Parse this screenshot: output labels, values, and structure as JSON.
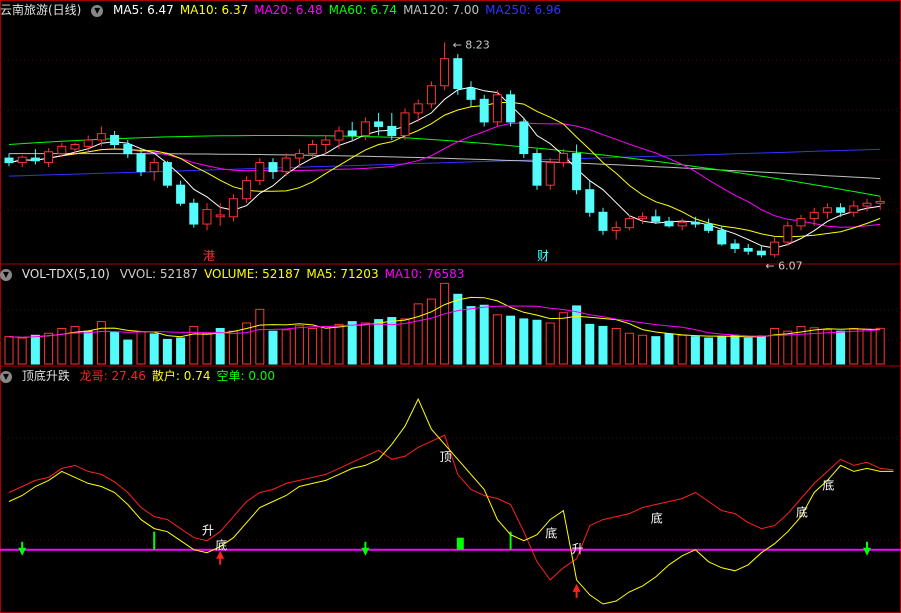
{
  "colors": {
    "bg": "#000000",
    "up": "#ff3333",
    "down": "#54fcfc",
    "frame": "#aa0000",
    "grid": "#5a0000",
    "ma5": "#ffffff",
    "ma10": "#ffff00",
    "ma20": "#ff00ff",
    "ma60": "#00ff00",
    "ma120": "#c0c0c0",
    "ma250": "#3333ff",
    "longge": "#ff2020",
    "sanhu": "#ffff00",
    "kongdan": "#00ff00",
    "zero_line": "#ff00ff"
  },
  "price_panel": {
    "title": "云南旅游(日线)",
    "ma": [
      {
        "label": "MA5: 6.47",
        "color": "#ffffff"
      },
      {
        "label": "MA10: 6.37",
        "color": "#ffff00"
      },
      {
        "label": "MA20: 6.48",
        "color": "#ff00ff"
      },
      {
        "label": "MA60: 6.74",
        "color": "#00ff00"
      },
      {
        "label": "MA120: 7.00",
        "color": "#c0c0c0"
      },
      {
        "label": "MA250: 6.96",
        "color": "#3333ff"
      }
    ],
    "high_label": "8.23",
    "low_label": "6.07",
    "marker_gang": "港",
    "marker_cai": "财"
  },
  "volume_panel": {
    "title": "VOL-TDX(5,10)",
    "items": [
      {
        "label": "VVOL: 52187",
        "color": "#cccccc"
      },
      {
        "label": "VOLUME: 52187",
        "color": "#ffff00"
      },
      {
        "label": "MA5: 71203",
        "color": "#ffff00"
      },
      {
        "label": "MA10: 76583",
        "color": "#ff00ff"
      }
    ]
  },
  "indicator_panel": {
    "title": "顶底升跌",
    "items": [
      {
        "label": "龙哥: 27.46",
        "color": "#ff2020"
      },
      {
        "label": "散户: 0.74",
        "color": "#ffff00"
      },
      {
        "label": "空单: 0.00",
        "color": "#00ff00"
      }
    ],
    "labels": [
      {
        "text": "升",
        "idx": 15
      },
      {
        "text": "底",
        "idx": 16
      },
      {
        "text": "顶",
        "idx": 33
      },
      {
        "text": "底",
        "idx": 41
      },
      {
        "text": "升",
        "idx": 43
      },
      {
        "text": "底",
        "idx": 49
      },
      {
        "text": "底",
        "idx": 60
      },
      {
        "text": "底",
        "idx": 62
      }
    ]
  },
  "chart_data": [
    {
      "type": "candlestick",
      "title": "云南旅游(日线)",
      "ylim": [
        5.8,
        8.5
      ],
      "ohlc": [
        [
          6.95,
          7.0,
          6.86,
          6.9
        ],
        [
          6.9,
          6.98,
          6.85,
          6.96
        ],
        [
          6.95,
          7.05,
          6.88,
          6.92
        ],
        [
          6.9,
          7.06,
          6.85,
          7.02
        ],
        [
          7.0,
          7.12,
          6.96,
          7.08
        ],
        [
          7.05,
          7.12,
          7.0,
          7.1
        ],
        [
          7.08,
          7.2,
          7.03,
          7.15
        ],
        [
          7.15,
          7.3,
          7.08,
          7.22
        ],
        [
          7.2,
          7.25,
          7.05,
          7.1
        ],
        [
          7.1,
          7.15,
          6.95,
          7.0
        ],
        [
          7.0,
          7.05,
          6.75,
          6.8
        ],
        [
          6.8,
          6.95,
          6.7,
          6.9
        ],
        [
          6.9,
          6.92,
          6.62,
          6.65
        ],
        [
          6.65,
          6.7,
          6.42,
          6.45
        ],
        [
          6.45,
          6.5,
          6.18,
          6.22
        ],
        [
          6.22,
          6.45,
          6.15,
          6.38
        ],
        [
          6.3,
          6.45,
          6.2,
          6.32
        ],
        [
          6.3,
          6.55,
          6.25,
          6.5
        ],
        [
          6.5,
          6.75,
          6.45,
          6.7
        ],
        [
          6.7,
          6.95,
          6.65,
          6.9
        ],
        [
          6.9,
          6.95,
          6.72,
          6.8
        ],
        [
          6.8,
          7.0,
          6.75,
          6.95
        ],
        [
          6.95,
          7.05,
          6.85,
          7.0
        ],
        [
          7.0,
          7.15,
          6.95,
          7.1
        ],
        [
          7.1,
          7.2,
          7.0,
          7.15
        ],
        [
          7.15,
          7.3,
          7.05,
          7.25
        ],
        [
          7.25,
          7.35,
          7.15,
          7.2
        ],
        [
          7.2,
          7.4,
          7.15,
          7.35
        ],
        [
          7.35,
          7.45,
          7.2,
          7.3
        ],
        [
          7.3,
          7.45,
          7.15,
          7.2
        ],
        [
          7.2,
          7.5,
          7.15,
          7.45
        ],
        [
          7.45,
          7.6,
          7.35,
          7.55
        ],
        [
          7.55,
          7.8,
          7.5,
          7.75
        ],
        [
          7.75,
          8.23,
          7.7,
          8.05
        ],
        [
          8.05,
          8.1,
          7.65,
          7.72
        ],
        [
          7.72,
          7.8,
          7.52,
          7.6
        ],
        [
          7.6,
          7.65,
          7.3,
          7.35
        ],
        [
          7.35,
          7.7,
          7.3,
          7.65
        ],
        [
          7.65,
          7.7,
          7.3,
          7.35
        ],
        [
          7.35,
          7.4,
          6.95,
          7.0
        ],
        [
          7.0,
          7.05,
          6.6,
          6.65
        ],
        [
          6.65,
          6.95,
          6.6,
          6.9
        ],
        [
          6.9,
          7.05,
          6.85,
          7.0
        ],
        [
          7.0,
          7.1,
          6.55,
          6.6
        ],
        [
          6.6,
          6.7,
          6.3,
          6.35
        ],
        [
          6.35,
          6.4,
          6.1,
          6.15
        ],
        [
          6.15,
          6.25,
          6.05,
          6.18
        ],
        [
          6.18,
          6.32,
          6.15,
          6.28
        ],
        [
          6.28,
          6.35,
          6.22,
          6.3
        ],
        [
          6.3,
          6.38,
          6.22,
          6.25
        ],
        [
          6.25,
          6.3,
          6.18,
          6.2
        ],
        [
          6.2,
          6.28,
          6.15,
          6.24
        ],
        [
          6.24,
          6.3,
          6.18,
          6.22
        ],
        [
          6.22,
          6.28,
          6.12,
          6.15
        ],
        [
          6.15,
          6.2,
          5.98,
          6.0
        ],
        [
          6.0,
          6.05,
          5.9,
          5.95
        ],
        [
          5.95,
          6.0,
          5.88,
          5.92
        ],
        [
          5.92,
          5.98,
          5.85,
          5.88
        ],
        [
          5.88,
          6.07,
          5.85,
          6.02
        ],
        [
          6.02,
          6.25,
          5.98,
          6.2
        ],
        [
          6.2,
          6.32,
          6.15,
          6.28
        ],
        [
          6.28,
          6.4,
          6.2,
          6.35
        ],
        [
          6.35,
          6.45,
          6.28,
          6.4
        ],
        [
          6.4,
          6.45,
          6.3,
          6.35
        ],
        [
          6.35,
          6.48,
          6.3,
          6.42
        ],
        [
          6.42,
          6.5,
          6.36,
          6.45
        ],
        [
          6.45,
          6.52,
          6.38,
          6.47
        ]
      ]
    },
    {
      "type": "bar",
      "title": "VOL-TDX(5,10)",
      "ylim": [
        0,
        120000
      ],
      "values": [
        40000,
        38000,
        42000,
        45000,
        52000,
        55000,
        48000,
        62000,
        46000,
        35000,
        47000,
        44000,
        36000,
        38000,
        55000,
        45000,
        52000,
        48000,
        60000,
        80000,
        48000,
        50000,
        56000,
        52000,
        55000,
        58000,
        62000,
        60000,
        65000,
        68000,
        66000,
        88000,
        95000,
        118000,
        102000,
        84000,
        86000,
        72000,
        70000,
        66000,
        64000,
        60000,
        75000,
        85000,
        58000,
        55000,
        52000,
        45000,
        42000,
        40000,
        44000,
        42000,
        40000,
        38000,
        40000,
        42000,
        38000,
        41000,
        52000,
        48000,
        55000,
        53000,
        50000,
        48000,
        52000,
        51000,
        52187
      ],
      "up": [
        1,
        1,
        0,
        1,
        1,
        1,
        0,
        1,
        0,
        0,
        1,
        0,
        0,
        0,
        1,
        1,
        0,
        1,
        1,
        1,
        0,
        1,
        1,
        1,
        1,
        1,
        0,
        1,
        0,
        0,
        1,
        1,
        1,
        1,
        0,
        0,
        0,
        1,
        0,
        0,
        0,
        1,
        1,
        0,
        0,
        0,
        1,
        1,
        1,
        0,
        0,
        1,
        0,
        0,
        0,
        0,
        0,
        0,
        1,
        1,
        1,
        1,
        1,
        0,
        1,
        1,
        1
      ]
    },
    {
      "type": "line",
      "title": "顶底升跌",
      "ylim": [
        -40,
        110
      ],
      "series": [
        {
          "name": "龙哥",
          "values": [
            38,
            42,
            46,
            48,
            54,
            56,
            52,
            50,
            45,
            38,
            28,
            22,
            20,
            14,
            8,
            6,
            12,
            22,
            32,
            38,
            40,
            44,
            46,
            48,
            50,
            54,
            58,
            62,
            66,
            60,
            62,
            68,
            72,
            76,
            50,
            40,
            36,
            34,
            30,
            12,
            -8,
            -20,
            -12,
            -6,
            16,
            20,
            22,
            24,
            28,
            30,
            32,
            34,
            38,
            32,
            26,
            24,
            18,
            14,
            16,
            24,
            34,
            44,
            52,
            60,
            56,
            58,
            54,
            53
          ]
        },
        {
          "name": "散户",
          "values": [
            32,
            36,
            42,
            46,
            52,
            48,
            44,
            42,
            38,
            30,
            20,
            14,
            12,
            6,
            0,
            -2,
            2,
            8,
            18,
            28,
            32,
            36,
            42,
            44,
            46,
            50,
            54,
            56,
            60,
            70,
            82,
            100,
            80,
            70,
            60,
            50,
            40,
            20,
            10,
            6,
            10,
            20,
            26,
            -20,
            -30,
            -36,
            -34,
            -28,
            -24,
            -18,
            -10,
            -4,
            0,
            -8,
            -12,
            -14,
            -10,
            -2,
            4,
            12,
            22,
            38,
            46,
            56,
            52,
            54,
            52,
            52
          ]
        },
        {
          "name": "空单",
          "values": [
            0,
            0,
            0,
            0,
            0,
            0,
            0,
            0,
            0,
            0,
            0,
            12,
            0,
            0,
            0,
            0,
            0,
            0,
            0,
            0,
            0,
            0,
            0,
            0,
            0,
            0,
            0,
            0,
            0,
            0,
            0,
            0,
            0,
            0,
            8,
            0,
            0,
            0,
            12,
            0,
            0,
            0,
            0,
            0,
            0,
            0,
            0,
            0,
            0,
            0,
            0,
            0,
            0,
            0,
            0,
            0,
            0,
            0,
            0,
            0,
            0,
            0,
            0,
            0,
            0,
            0,
            0,
            0
          ]
        }
      ],
      "arrows_down": [
        1,
        27,
        65
      ],
      "arrows_up": [
        16,
        43
      ]
    }
  ]
}
